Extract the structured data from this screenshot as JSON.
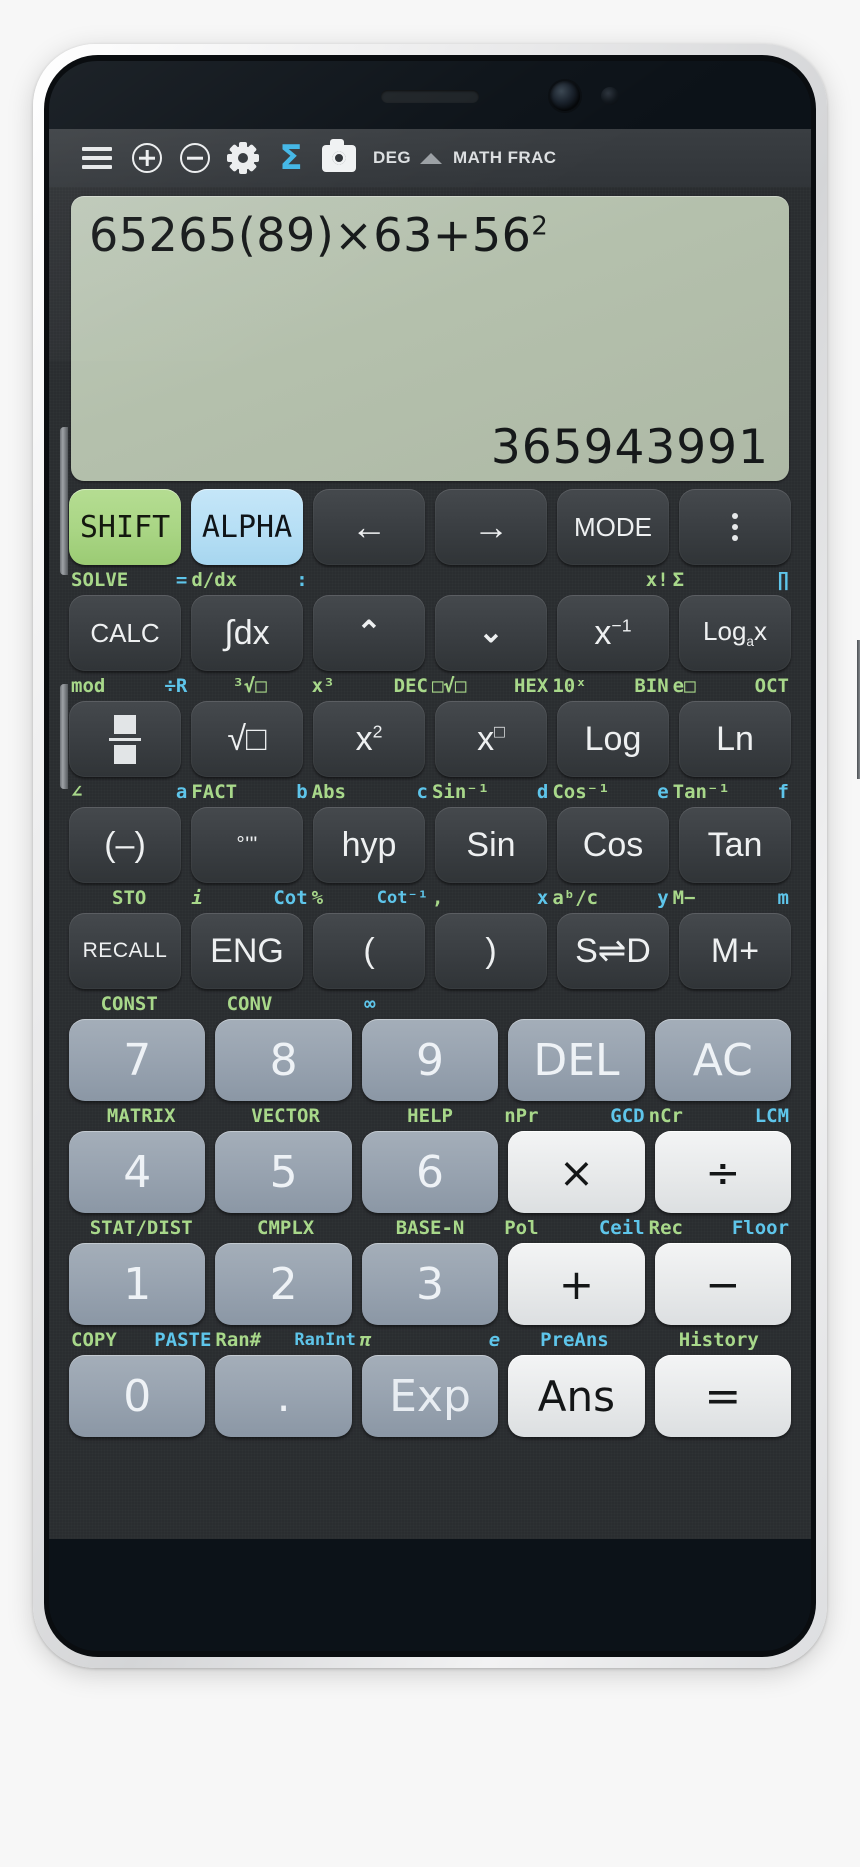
{
  "toolbar": {
    "menu_icon": "hamburger-menu-icon",
    "zoom_in_icon": "plus-circle-icon",
    "zoom_out_icon": "minus-circle-icon",
    "settings_icon": "gear-icon",
    "sigma_icon": "sigma-icon",
    "sigma_glyph": "Σ",
    "screenshot_icon": "camera-icon",
    "angle_mode": "DEG",
    "indicator_icon": "triangle-up-icon",
    "display_mode": "MATH FRAC"
  },
  "display": {
    "expression_text": "65265(89)×63+56",
    "expression_exponent": "2",
    "result": "365943991"
  },
  "colors": {
    "shift_green": "#a9d584",
    "alpha_blue": "#b6dff5",
    "sub_green": "#a8d88a",
    "sub_cyan": "#5ec5ea",
    "display_bg": "#b4c0ac",
    "accent_sigma": "#41b6e6"
  },
  "keypad": {
    "rows": [
      {
        "keys": [
          {
            "label": "SHIFT",
            "style": "shift",
            "name": "shift"
          },
          {
            "label": "ALPHA",
            "style": "alpha",
            "name": "alpha"
          },
          {
            "label": "←",
            "style": "dark",
            "name": "arrow-left"
          },
          {
            "label": "→",
            "style": "dark",
            "name": "arrow-right"
          },
          {
            "label": "MODE",
            "style": "dark",
            "name": "mode"
          },
          {
            "label": "⋮",
            "style": "dark",
            "name": "overflow-menu"
          }
        ],
        "sub": [
          {
            "green": "SOLVE",
            "cyan": "="
          },
          {
            "green": "d/dx",
            "cyan": ":"
          },
          {
            "green": "",
            "cyan": ""
          },
          {
            "green": "",
            "cyan": ""
          },
          {
            "green": "x!",
            "cyan": ""
          },
          {
            "green": "Σ",
            "cyan": "∏"
          }
        ]
      },
      {
        "keys": [
          {
            "label": "CALC",
            "style": "dark",
            "name": "calc"
          },
          {
            "label": "∫dx",
            "style": "dark",
            "name": "integral"
          },
          {
            "label": "⌃",
            "style": "dark",
            "name": "cursor-up"
          },
          {
            "label": "⌄",
            "style": "dark",
            "name": "cursor-down"
          },
          {
            "label": "x⁻¹",
            "style": "dark",
            "name": "reciprocal"
          },
          {
            "label": "Logₐx",
            "style": "dark",
            "name": "log-base-a"
          }
        ],
        "sub": [
          {
            "green": "mod",
            "cyan": "÷R"
          },
          {
            "green": "³√□",
            "cyan": ""
          },
          {
            "green": "x³",
            "cyan": "DEC"
          },
          {
            "green": "□√□",
            "cyan": "HEX"
          },
          {
            "green": "10ˣ",
            "cyan": "BIN"
          },
          {
            "green": "e□",
            "cyan": "OCT"
          }
        ]
      },
      {
        "keys": [
          {
            "label": "fraction",
            "style": "dark",
            "name": "fraction"
          },
          {
            "label": "√□",
            "style": "dark",
            "name": "square-root"
          },
          {
            "label": "x²",
            "style": "dark",
            "name": "square"
          },
          {
            "label": "x□",
            "style": "dark",
            "name": "power"
          },
          {
            "label": "Log",
            "style": "dark",
            "name": "log"
          },
          {
            "label": "Ln",
            "style": "dark",
            "name": "ln"
          }
        ],
        "sub": [
          {
            "green": "∠",
            "cyan": "a"
          },
          {
            "green": "FACT",
            "cyan": "b"
          },
          {
            "green": "Abs",
            "cyan": "c"
          },
          {
            "green": "Sin⁻¹",
            "cyan": "d"
          },
          {
            "green": "Cos⁻¹",
            "cyan": "e"
          },
          {
            "green": "Tan⁻¹",
            "cyan": "f"
          }
        ]
      },
      {
        "keys": [
          {
            "label": "(–)",
            "style": "dark",
            "name": "negate"
          },
          {
            "label": "°'\"",
            "style": "dark",
            "name": "degrees-minutes-seconds"
          },
          {
            "label": "hyp",
            "style": "dark",
            "name": "hyp"
          },
          {
            "label": "Sin",
            "style": "dark",
            "name": "sin"
          },
          {
            "label": "Cos",
            "style": "dark",
            "name": "cos"
          },
          {
            "label": "Tan",
            "style": "dark",
            "name": "tan"
          }
        ],
        "sub": [
          {
            "green": "STO",
            "cyan": ""
          },
          {
            "green": "i",
            "cyan": "Cot"
          },
          {
            "green": "%",
            "cyan": "Cot⁻¹"
          },
          {
            "green": ",",
            "cyan": "x"
          },
          {
            "green": "aᵇ/c",
            "cyan": "y"
          },
          {
            "green": "M−",
            "cyan": "m"
          }
        ]
      },
      {
        "keys": [
          {
            "label": "RECALL",
            "style": "dark",
            "name": "recall"
          },
          {
            "label": "ENG",
            "style": "dark",
            "name": "eng"
          },
          {
            "label": "(",
            "style": "dark",
            "name": "open-paren"
          },
          {
            "label": ")",
            "style": "dark",
            "name": "close-paren"
          },
          {
            "label": "S⇌D",
            "style": "dark",
            "name": "s-to-d"
          },
          {
            "label": "M+",
            "style": "dark",
            "name": "memory-plus"
          }
        ],
        "sub": [
          {
            "green": "CONST",
            "cyan": ""
          },
          {
            "green": "CONV",
            "cyan": ""
          },
          {
            "green": "",
            "cyan": "∞"
          },
          {
            "green": "",
            "cyan": ""
          },
          {
            "green": "",
            "cyan": ""
          },
          {
            "green": "",
            "cyan": ""
          }
        ]
      },
      {
        "keys": [
          {
            "label": "7",
            "style": "num",
            "name": "digit-7"
          },
          {
            "label": "8",
            "style": "num",
            "name": "digit-8"
          },
          {
            "label": "9",
            "style": "num",
            "name": "digit-9"
          },
          {
            "label": "DEL",
            "style": "num",
            "name": "delete"
          },
          {
            "label": "AC",
            "style": "num",
            "name": "all-clear"
          }
        ],
        "sub": [
          {
            "green": "MATRIX",
            "cyan": ""
          },
          {
            "green": "VECTOR",
            "cyan": ""
          },
          {
            "green": "HELP",
            "cyan": ""
          },
          {
            "green": "nPr",
            "cyan": "GCD"
          },
          {
            "green": "nCr",
            "cyan": "LCM"
          }
        ]
      },
      {
        "keys": [
          {
            "label": "4",
            "style": "num",
            "name": "digit-4"
          },
          {
            "label": "5",
            "style": "num",
            "name": "digit-5"
          },
          {
            "label": "6",
            "style": "num",
            "name": "digit-6"
          },
          {
            "label": "×",
            "style": "op",
            "name": "multiply"
          },
          {
            "label": "÷",
            "style": "op",
            "name": "divide"
          }
        ],
        "sub": [
          {
            "green": "STAT/DIST",
            "cyan": ""
          },
          {
            "green": "CMPLX",
            "cyan": ""
          },
          {
            "green": "BASE-N",
            "cyan": ""
          },
          {
            "green": "Pol",
            "cyan": "Ceil"
          },
          {
            "green": "Rec",
            "cyan": "Floor"
          }
        ]
      },
      {
        "keys": [
          {
            "label": "1",
            "style": "num",
            "name": "digit-1"
          },
          {
            "label": "2",
            "style": "num",
            "name": "digit-2"
          },
          {
            "label": "3",
            "style": "num",
            "name": "digit-3"
          },
          {
            "label": "+",
            "style": "op",
            "name": "plus"
          },
          {
            "label": "−",
            "style": "op",
            "name": "minus"
          }
        ],
        "sub": [
          {
            "green": "COPY",
            "cyan": "PASTE"
          },
          {
            "green": "Ran#",
            "cyan": "RanInt"
          },
          {
            "green": "π",
            "cyan": "e"
          },
          {
            "green": "",
            "cyan": "PreAns"
          },
          {
            "green": "History",
            "cyan": ""
          }
        ]
      },
      {
        "keys": [
          {
            "label": "0",
            "style": "num",
            "name": "digit-0"
          },
          {
            "label": ".",
            "style": "num",
            "name": "decimal-point"
          },
          {
            "label": "Exp",
            "style": "num",
            "name": "exponent"
          },
          {
            "label": "Ans",
            "style": "op",
            "name": "answer"
          },
          {
            "label": "=",
            "style": "op",
            "name": "equals"
          }
        ],
        "sub": []
      }
    ]
  }
}
